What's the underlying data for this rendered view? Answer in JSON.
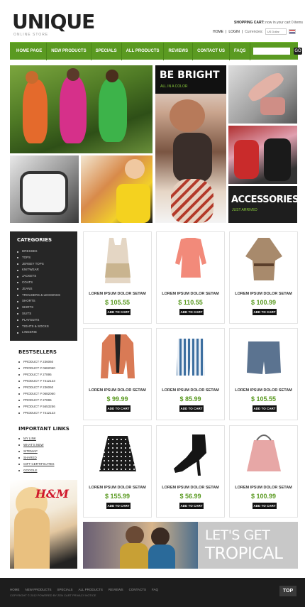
{
  "header": {
    "logo": "UNIQUE",
    "tagline": "ONLINE STORE",
    "cart_label": "SHOPPING CART:",
    "cart_status": "now in your cart 0 items",
    "links": [
      "HOME",
      "LOGIN"
    ],
    "currencies_label": "Currencies:",
    "currency_value": "US Dollar"
  },
  "nav": {
    "items": [
      "HOME PAGE",
      "NEW PRODUCTS",
      "SPECIALS",
      "ALL PRODUCTS",
      "REVIEWS",
      "CONTACT US",
      "FAQS"
    ],
    "search_label": "SEARCH",
    "search_button": "GO"
  },
  "hero": {
    "bright_title": "BE BRIGHT",
    "bright_sub": "ALL IN A COLOR",
    "accessories_title": "ACCESSORIES",
    "accessories_sub": "JUST ARRIVED"
  },
  "sidebar": {
    "categories_title": "CATEGORIES",
    "categories": [
      "DRESSES",
      "TOPS",
      "JERSEY TOPS",
      "KNITWEAR",
      "JACKETS",
      "COATS",
      "JEANS",
      "TROUSERS & LEGGINGS",
      "SHORTS",
      "SKIRTS",
      "SUITS",
      "PLAYSUITS",
      "TIGHTS & SOCKS",
      "LINGERIE"
    ],
    "bestsellers_title": "BESTSELLERS",
    "bestsellers": [
      "PRODUCT # 236060",
      "PRODUCT # 0682060",
      "PRODUCT # 27895",
      "PRODUCT # 7412123",
      "PRODUCT # 236060",
      "PRODUCT # 0682060",
      "PRODUCT # 27895",
      "PRODUCT # 5653256",
      "PRODUCT # 7412123"
    ],
    "links_title": "IMPORTANT LINKS",
    "links": [
      "MY LINK",
      "WHAT'S NEW",
      "SITEMAP",
      "SHARED",
      "GIFT CERTIFICATES",
      "GOOGLE"
    ],
    "banner_logo": "H&M"
  },
  "products": [
    {
      "name": "LOREM IPSUM DOLOR SETAM",
      "price": "$ 105.55",
      "button": "ADD TO CART"
    },
    {
      "name": "LOREM IPSUM DOLOR SETAM",
      "price": "$ 110.55",
      "button": "ADD TO CART"
    },
    {
      "name": "LOREM IPSUM DOLOR SETAM",
      "price": "$ 100.99",
      "button": "ADD TO CART"
    },
    {
      "name": "LOREM IPSUM DOLOR SETAM",
      "price": "$ 99.99",
      "button": "ADD TO CART"
    },
    {
      "name": "LOREM IPSUM DOLOR SETAM",
      "price": "$ 85.99",
      "button": "ADD TO CART"
    },
    {
      "name": "LOREM IPSUM DOLOR SETAM",
      "price": "$ 105.55",
      "button": "ADD TO CART"
    },
    {
      "name": "LOREM IPSUM DOLOR SETAM",
      "price": "$ 155.99",
      "button": "ADD TO CART"
    },
    {
      "name": "LOREM IPSUM DOLOR SETAM",
      "price": "$ 56.99",
      "button": "ADD TO CART"
    },
    {
      "name": "LOREM IPSUM DOLOR SETAM",
      "price": "$ 100.99",
      "button": "ADD TO CART"
    }
  ],
  "banner": {
    "line1": "LET'S GET",
    "line2": "TROPICAL"
  },
  "footer": {
    "items": [
      "HOME",
      "NEW PRODUCTS",
      "SPECIALS",
      "ALL PRODUCTS",
      "REVIEWS",
      "CONTACTS",
      "FAQ"
    ],
    "copyright": "COPYRIGHT © 2012 POWERED BY ZEN CART PRIVACY NOTICE",
    "top_button": "TOP"
  },
  "colors": {
    "accent_green": "#5a9a21",
    "dark": "#262626"
  }
}
